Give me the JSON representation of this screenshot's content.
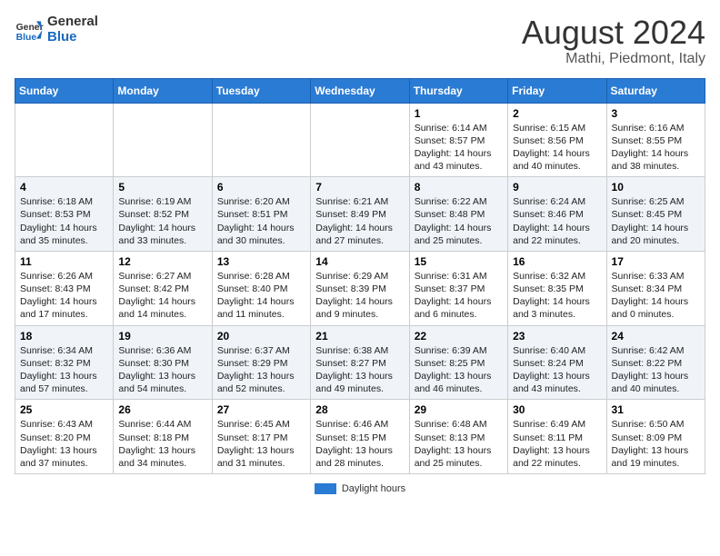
{
  "header": {
    "logo_general": "General",
    "logo_blue": "Blue",
    "month_year": "August 2024",
    "location": "Mathi, Piedmont, Italy"
  },
  "days_of_week": [
    "Sunday",
    "Monday",
    "Tuesday",
    "Wednesday",
    "Thursday",
    "Friday",
    "Saturday"
  ],
  "weeks": [
    {
      "cells": [
        {
          "day": "",
          "content": ""
        },
        {
          "day": "",
          "content": ""
        },
        {
          "day": "",
          "content": ""
        },
        {
          "day": "",
          "content": ""
        },
        {
          "day": "1",
          "content": "Sunrise: 6:14 AM\nSunset: 8:57 PM\nDaylight: 14 hours\nand 43 minutes."
        },
        {
          "day": "2",
          "content": "Sunrise: 6:15 AM\nSunset: 8:56 PM\nDaylight: 14 hours\nand 40 minutes."
        },
        {
          "day": "3",
          "content": "Sunrise: 6:16 AM\nSunset: 8:55 PM\nDaylight: 14 hours\nand 38 minutes."
        }
      ]
    },
    {
      "cells": [
        {
          "day": "4",
          "content": "Sunrise: 6:18 AM\nSunset: 8:53 PM\nDaylight: 14 hours\nand 35 minutes."
        },
        {
          "day": "5",
          "content": "Sunrise: 6:19 AM\nSunset: 8:52 PM\nDaylight: 14 hours\nand 33 minutes."
        },
        {
          "day": "6",
          "content": "Sunrise: 6:20 AM\nSunset: 8:51 PM\nDaylight: 14 hours\nand 30 minutes."
        },
        {
          "day": "7",
          "content": "Sunrise: 6:21 AM\nSunset: 8:49 PM\nDaylight: 14 hours\nand 27 minutes."
        },
        {
          "day": "8",
          "content": "Sunrise: 6:22 AM\nSunset: 8:48 PM\nDaylight: 14 hours\nand 25 minutes."
        },
        {
          "day": "9",
          "content": "Sunrise: 6:24 AM\nSunset: 8:46 PM\nDaylight: 14 hours\nand 22 minutes."
        },
        {
          "day": "10",
          "content": "Sunrise: 6:25 AM\nSunset: 8:45 PM\nDaylight: 14 hours\nand 20 minutes."
        }
      ]
    },
    {
      "cells": [
        {
          "day": "11",
          "content": "Sunrise: 6:26 AM\nSunset: 8:43 PM\nDaylight: 14 hours\nand 17 minutes."
        },
        {
          "day": "12",
          "content": "Sunrise: 6:27 AM\nSunset: 8:42 PM\nDaylight: 14 hours\nand 14 minutes."
        },
        {
          "day": "13",
          "content": "Sunrise: 6:28 AM\nSunset: 8:40 PM\nDaylight: 14 hours\nand 11 minutes."
        },
        {
          "day": "14",
          "content": "Sunrise: 6:29 AM\nSunset: 8:39 PM\nDaylight: 14 hours\nand 9 minutes."
        },
        {
          "day": "15",
          "content": "Sunrise: 6:31 AM\nSunset: 8:37 PM\nDaylight: 14 hours\nand 6 minutes."
        },
        {
          "day": "16",
          "content": "Sunrise: 6:32 AM\nSunset: 8:35 PM\nDaylight: 14 hours\nand 3 minutes."
        },
        {
          "day": "17",
          "content": "Sunrise: 6:33 AM\nSunset: 8:34 PM\nDaylight: 14 hours\nand 0 minutes."
        }
      ]
    },
    {
      "cells": [
        {
          "day": "18",
          "content": "Sunrise: 6:34 AM\nSunset: 8:32 PM\nDaylight: 13 hours\nand 57 minutes."
        },
        {
          "day": "19",
          "content": "Sunrise: 6:36 AM\nSunset: 8:30 PM\nDaylight: 13 hours\nand 54 minutes."
        },
        {
          "day": "20",
          "content": "Sunrise: 6:37 AM\nSunset: 8:29 PM\nDaylight: 13 hours\nand 52 minutes."
        },
        {
          "day": "21",
          "content": "Sunrise: 6:38 AM\nSunset: 8:27 PM\nDaylight: 13 hours\nand 49 minutes."
        },
        {
          "day": "22",
          "content": "Sunrise: 6:39 AM\nSunset: 8:25 PM\nDaylight: 13 hours\nand 46 minutes."
        },
        {
          "day": "23",
          "content": "Sunrise: 6:40 AM\nSunset: 8:24 PM\nDaylight: 13 hours\nand 43 minutes."
        },
        {
          "day": "24",
          "content": "Sunrise: 6:42 AM\nSunset: 8:22 PM\nDaylight: 13 hours\nand 40 minutes."
        }
      ]
    },
    {
      "cells": [
        {
          "day": "25",
          "content": "Sunrise: 6:43 AM\nSunset: 8:20 PM\nDaylight: 13 hours\nand 37 minutes."
        },
        {
          "day": "26",
          "content": "Sunrise: 6:44 AM\nSunset: 8:18 PM\nDaylight: 13 hours\nand 34 minutes."
        },
        {
          "day": "27",
          "content": "Sunrise: 6:45 AM\nSunset: 8:17 PM\nDaylight: 13 hours\nand 31 minutes."
        },
        {
          "day": "28",
          "content": "Sunrise: 6:46 AM\nSunset: 8:15 PM\nDaylight: 13 hours\nand 28 minutes."
        },
        {
          "day": "29",
          "content": "Sunrise: 6:48 AM\nSunset: 8:13 PM\nDaylight: 13 hours\nand 25 minutes."
        },
        {
          "day": "30",
          "content": "Sunrise: 6:49 AM\nSunset: 8:11 PM\nDaylight: 13 hours\nand 22 minutes."
        },
        {
          "day": "31",
          "content": "Sunrise: 6:50 AM\nSunset: 8:09 PM\nDaylight: 13 hours\nand 19 minutes."
        }
      ]
    }
  ],
  "footer": {
    "legend_label": "Daylight hours"
  }
}
